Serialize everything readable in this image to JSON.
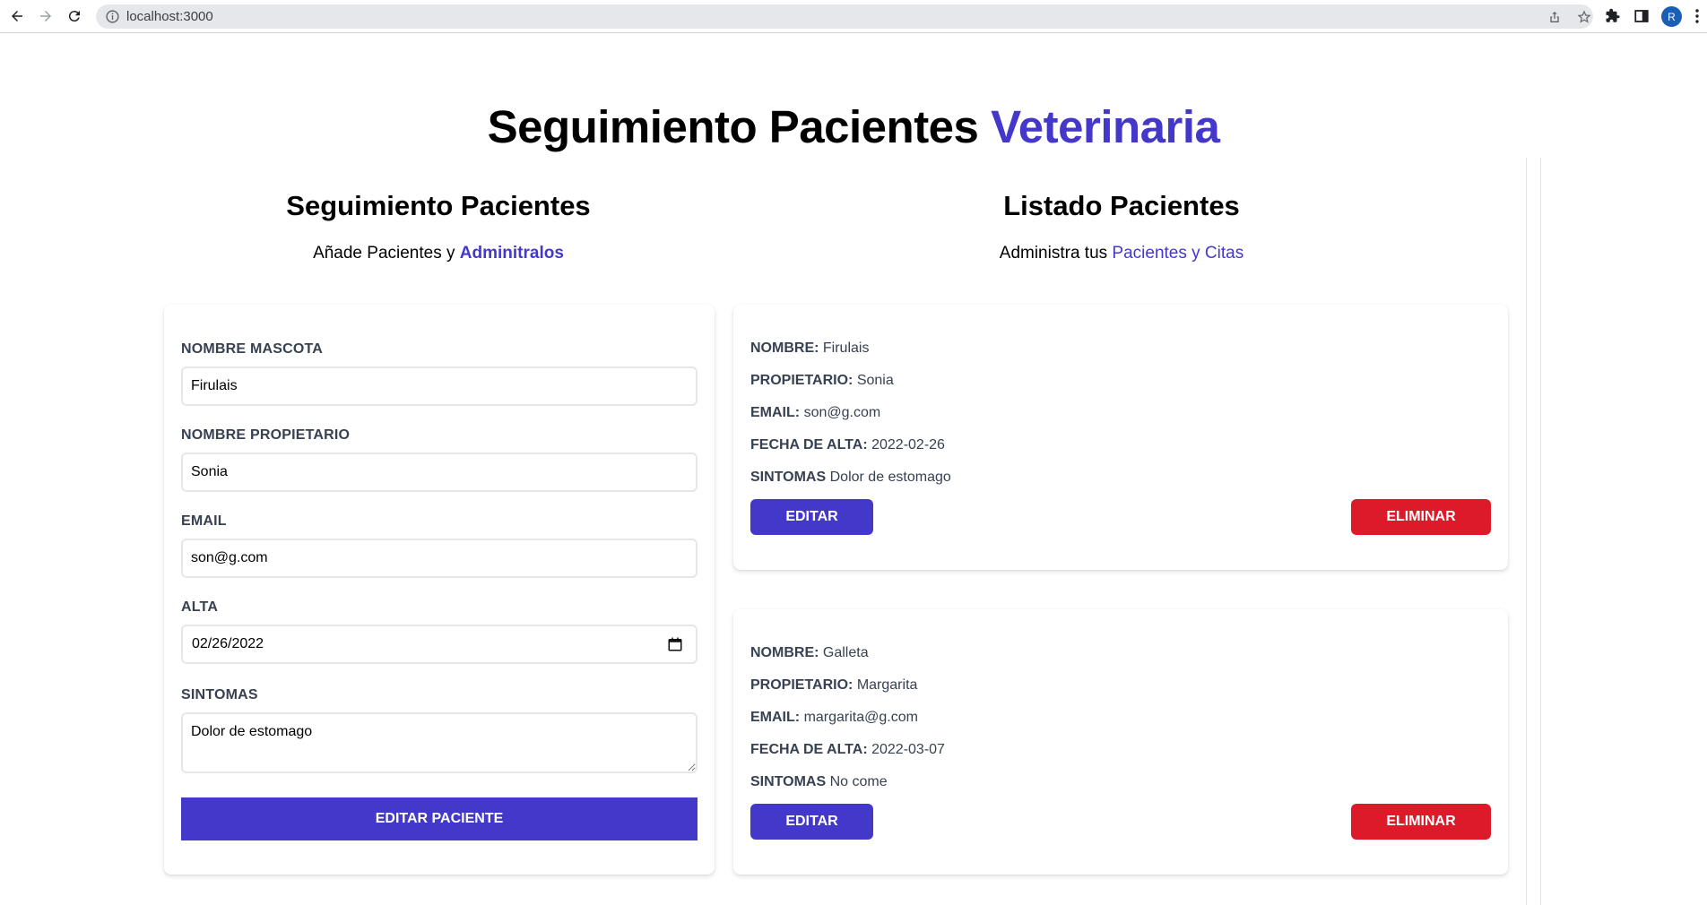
{
  "browser": {
    "url": "localhost:3000",
    "avatar_letter": "R"
  },
  "header": {
    "title_main": "Seguimiento Pacientes",
    "title_accent": "Veterinaria"
  },
  "form_section": {
    "title": "Seguimiento Pacientes",
    "subtitle_prefix": "Añade Pacientes y",
    "subtitle_accent": "Adminitralos",
    "fields": {
      "pet_name_label": "NOMBRE MASCOTA",
      "pet_name_value": "Firulais",
      "owner_label": "NOMBRE PROPIETARIO",
      "owner_value": "Sonia",
      "email_label": "EMAIL",
      "email_value": "son@g.com",
      "date_label": "ALTA",
      "date_value": "02/26/2022",
      "symptoms_label": "SINTOMAS",
      "symptoms_value": "Dolor de estomago"
    },
    "submit_label": "EDITAR PACIENTE"
  },
  "list_section": {
    "title": "Listado Pacientes",
    "subtitle_prefix": "Administra tus",
    "subtitle_accent": "Pacientes y Citas",
    "labels": {
      "name": "NOMBRE:",
      "owner": "PROPIETARIO:",
      "email": "EMAIL:",
      "date": "FECHA DE ALTA:",
      "symptoms": "SINTOMAS"
    },
    "edit_label": "EDITAR",
    "delete_label": "ELIMINAR",
    "patients": [
      {
        "name": "Firulais",
        "owner": "Sonia",
        "email": "son@g.com",
        "date": "2022-02-26",
        "symptoms": "Dolor de estomago"
      },
      {
        "name": "Galleta",
        "owner": "Margarita",
        "email": "margarita@g.com",
        "date": "2022-03-07",
        "symptoms": "No come"
      }
    ]
  },
  "colors": {
    "accent": "#4338ca",
    "danger": "#dc1a2a"
  }
}
